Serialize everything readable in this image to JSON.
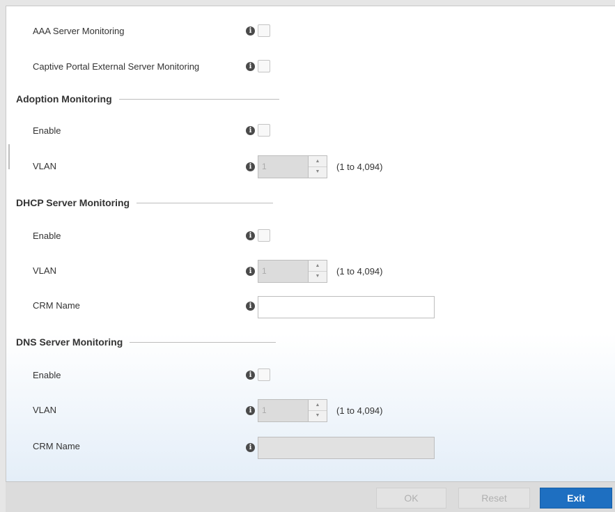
{
  "server_monitoring": {
    "aaa_label": "AAA Server Monitoring",
    "captive_portal_label": "Captive Portal External Server Monitoring"
  },
  "adoption": {
    "title": "Adoption Monitoring",
    "enable_label": "Enable",
    "vlan_label": "VLAN",
    "vlan_value": "1",
    "vlan_range": "(1 to 4,094)"
  },
  "dhcp": {
    "title": "DHCP Server Monitoring",
    "enable_label": "Enable",
    "vlan_label": "VLAN",
    "vlan_value": "1",
    "vlan_range": "(1 to 4,094)",
    "crm_label": "CRM Name",
    "crm_value": ""
  },
  "dns": {
    "title": "DNS Server Monitoring",
    "enable_label": "Enable",
    "vlan_label": "VLAN",
    "vlan_value": "1",
    "vlan_range": "(1 to 4,094)",
    "crm_label": "CRM Name",
    "crm_value": ""
  },
  "footer": {
    "ok_label": "OK",
    "reset_label": "Reset",
    "exit_label": "Exit"
  },
  "icons": {
    "info": "i",
    "spin_up": "▲",
    "spin_down": "▼"
  },
  "colors": {
    "accent": "#1e6fc1",
    "disabled_field": "#dcdcdc"
  }
}
